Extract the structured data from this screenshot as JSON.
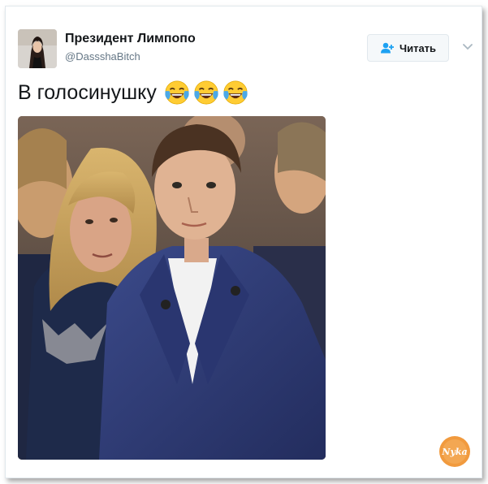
{
  "tweet": {
    "author_name": "Президент Лимпопо",
    "author_handle": "@DassshaBitch",
    "follow_label": "Читать",
    "text": "В голосинушку",
    "emojis": [
      "face-with-tears-of-joy",
      "face-with-tears-of-joy",
      "face-with-tears-of-joy"
    ]
  },
  "colors": {
    "follow_icon": "#1da1f2",
    "emoji_face": "#ffcc33",
    "tears": "#4aa8e8",
    "logo_bg": "#f19a3e"
  },
  "watermark": {
    "text": "Nyka"
  }
}
